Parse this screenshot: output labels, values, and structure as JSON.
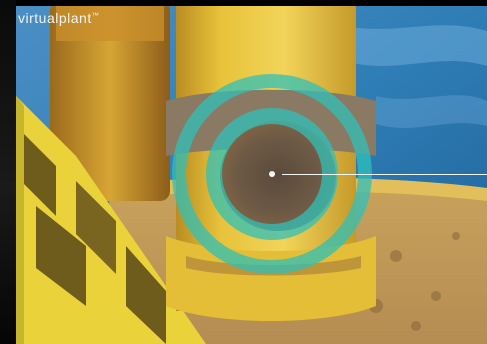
{
  "brand": {
    "logo_text": "virtualplant",
    "trademark": "™"
  },
  "colors": {
    "water": "#2f7db6",
    "pipe_yellow": "#e8c33a",
    "rust": "#7a5a3a",
    "ring": "#2fc0b8",
    "frame": "#000000"
  },
  "marker": {
    "icon": "corrosion-target-icon",
    "callout": "leader-line"
  }
}
